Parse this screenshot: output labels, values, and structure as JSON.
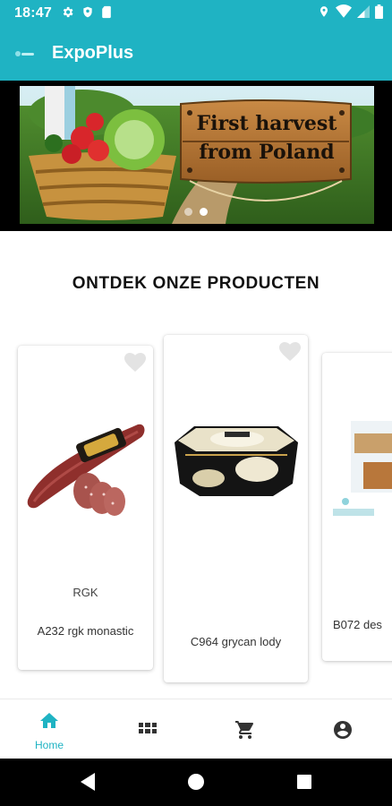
{
  "status_bar": {
    "time": "18:47",
    "icons_left": [
      "gear-icon",
      "shield-icon",
      "sim-card-icon"
    ],
    "icons_right": [
      "location-icon",
      "wifi-icon",
      "signal-icon",
      "battery-icon"
    ]
  },
  "app_bar": {
    "title": "ExpoPlus",
    "logo": "expoplus-logo"
  },
  "banner": {
    "line1": "First harvest",
    "line2": "from Poland",
    "slide_count": 2,
    "active_slide": 2
  },
  "section": {
    "title": "ONTDEK ONZE PRODUCTEN"
  },
  "products": [
    {
      "brand": "RGK",
      "name": "A232 rgk monastic",
      "favorite_icon": "heart-icon"
    },
    {
      "brand": "",
      "name": "C964 grycan lody",
      "favorite_icon": "heart-icon"
    },
    {
      "brand": "",
      "name": "B072 des",
      "favorite_icon": "heart-icon"
    }
  ],
  "bottom_nav": {
    "items": [
      {
        "label": "Home",
        "icon": "home-icon",
        "active": true
      },
      {
        "label": "",
        "icon": "grid-icon",
        "active": false
      },
      {
        "label": "",
        "icon": "cart-icon",
        "active": false
      },
      {
        "label": "",
        "icon": "account-icon",
        "active": false
      }
    ]
  },
  "colors": {
    "primary": "#1fb3c3",
    "inactive_icon": "#333333"
  }
}
